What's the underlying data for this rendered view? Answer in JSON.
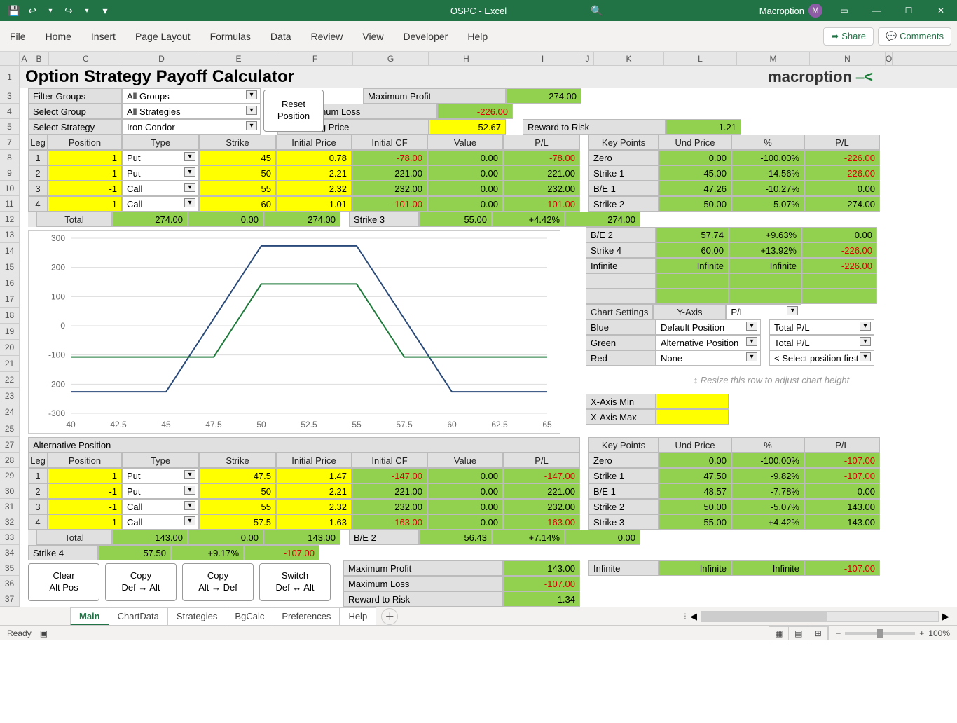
{
  "app": {
    "title": "OSPC  -  Excel",
    "account": "Macroption",
    "avatar_letter": "M"
  },
  "ribbon": {
    "tabs": [
      "File",
      "Home",
      "Insert",
      "Page Layout",
      "Formulas",
      "Data",
      "Review",
      "View",
      "Developer",
      "Help"
    ],
    "share": "Share",
    "comments": "Comments"
  },
  "col_headers": [
    "A",
    "B",
    "C",
    "D",
    "E",
    "F",
    "G",
    "H",
    "I",
    "J",
    "K",
    "L",
    "M",
    "N",
    "O"
  ],
  "row_numbers_top": [
    1,
    3,
    4,
    5,
    7,
    8,
    9,
    10,
    11,
    12,
    13,
    14,
    15,
    16,
    17,
    18,
    19,
    20,
    21,
    22,
    23,
    24,
    25,
    27,
    28,
    29,
    30,
    31,
    32,
    33,
    34,
    35,
    36,
    37
  ],
  "title": "Option Strategy Payoff Calculator",
  "brand": "macroption",
  "filters": {
    "filter_groups_label": "Filter Groups",
    "select_group_label": "Select Group",
    "select_strategy_label": "Select Strategy",
    "filter_groups_value": "All Groups",
    "select_group_value": "All Strategies",
    "select_strategy_value": "Iron Condor",
    "reset_btn_l1": "Reset",
    "reset_btn_l2": "Position",
    "underlying_label": "Underlying Price",
    "underlying_value": "52.67"
  },
  "summary_top": {
    "max_profit_label": "Maximum Profit",
    "max_profit": "274.00",
    "max_loss_label": "Maximum Loss",
    "max_loss": "-226.00",
    "reward_label": "Reward to Risk",
    "reward": "1.21"
  },
  "pos_headers": [
    "Leg",
    "Position",
    "Type",
    "Strike",
    "Initial Price",
    "Initial CF",
    "Value",
    "P/L"
  ],
  "legs_main": [
    {
      "leg": "1",
      "pos": "1",
      "type": "Put",
      "strike": "45",
      "iprice": "0.78",
      "icf": "-78.00",
      "value": "0.00",
      "pl": "-78.00",
      "icf_neg": true,
      "pl_neg": true
    },
    {
      "leg": "2",
      "pos": "-1",
      "type": "Put",
      "strike": "50",
      "iprice": "2.21",
      "icf": "221.00",
      "value": "0.00",
      "pl": "221.00",
      "icf_neg": false,
      "pl_neg": false
    },
    {
      "leg": "3",
      "pos": "-1",
      "type": "Call",
      "strike": "55",
      "iprice": "2.32",
      "icf": "232.00",
      "value": "0.00",
      "pl": "232.00",
      "icf_neg": false,
      "pl_neg": false
    },
    {
      "leg": "4",
      "pos": "1",
      "type": "Call",
      "strike": "60",
      "iprice": "1.01",
      "icf": "-101.00",
      "value": "0.00",
      "pl": "-101.00",
      "icf_neg": true,
      "pl_neg": true
    }
  ],
  "total_label": "Total",
  "totals_main": {
    "icf": "274.00",
    "value": "0.00",
    "pl": "274.00"
  },
  "keypoints_headers": [
    "Key Points",
    "Und Price",
    "%",
    "P/L"
  ],
  "keypoints_top": [
    {
      "name": "Zero",
      "price": "0.00",
      "pct": "-100.00%",
      "pl": "-226.00",
      "pl_neg": true
    },
    {
      "name": "Strike 1",
      "price": "45.00",
      "pct": "-14.56%",
      "pl": "-226.00",
      "pl_neg": true
    },
    {
      "name": "B/E 1",
      "price": "47.26",
      "pct": "-10.27%",
      "pl": "0.00",
      "pl_neg": false
    },
    {
      "name": "Strike 2",
      "price": "50.00",
      "pct": "-5.07%",
      "pl": "274.00",
      "pl_neg": false
    },
    {
      "name": "Strike 3",
      "price": "55.00",
      "pct": "+4.42%",
      "pl": "274.00",
      "pl_neg": false
    },
    {
      "name": "B/E 2",
      "price": "57.74",
      "pct": "+9.63%",
      "pl": "0.00",
      "pl_neg": false
    },
    {
      "name": "Strike 4",
      "price": "60.00",
      "pct": "+13.92%",
      "pl": "-226.00",
      "pl_neg": true
    },
    {
      "name": "Infinite",
      "price": "Infinite",
      "pct": "Infinite",
      "pl": "-226.00",
      "pl_neg": true
    }
  ],
  "chart_settings": {
    "header": "Chart Settings",
    "yaxis_label": "Y-Axis",
    "yaxis_value": "P/L",
    "rows": [
      {
        "color": "Blue",
        "pos": "Default Position",
        "metric": "Total P/L"
      },
      {
        "color": "Green",
        "pos": "Alternative Position",
        "metric": "Total P/L"
      },
      {
        "color": "Red",
        "pos": "None",
        "metric": "< Select position first"
      }
    ],
    "resize_hint": "↕ Resize this row to adjust chart height",
    "xmin_label": "X-Axis Min",
    "xmax_label": "X-Axis Max"
  },
  "chart_data": {
    "type": "line",
    "x": [
      40,
      42.5,
      45,
      47.5,
      50,
      52.5,
      55,
      57.5,
      60,
      62.5,
      65
    ],
    "series": [
      {
        "name": "Default Position",
        "color": "#2a4a7a",
        "values": [
          -226,
          -226,
          -226,
          24,
          274,
          274,
          274,
          24,
          -226,
          -226,
          -226
        ]
      },
      {
        "name": "Alternative Position",
        "color": "#1e7a3a",
        "values": [
          -107,
          -107,
          -107,
          -107,
          143,
          143,
          143,
          -107,
          -107,
          -107,
          -107
        ]
      }
    ],
    "xlabel": "",
    "ylabel": "",
    "ylim": [
      -300,
      300
    ],
    "yticks": [
      -300,
      -200,
      -100,
      0,
      100,
      200,
      300
    ],
    "xticks": [
      40,
      42.5,
      45,
      47.5,
      50,
      52.5,
      55,
      57.5,
      60,
      62.5,
      65
    ]
  },
  "alt_header": "Alternative Position",
  "legs_alt": [
    {
      "leg": "1",
      "pos": "1",
      "type": "Put",
      "strike": "47.5",
      "iprice": "1.47",
      "icf": "-147.00",
      "value": "0.00",
      "pl": "-147.00",
      "icf_neg": true,
      "pl_neg": true
    },
    {
      "leg": "2",
      "pos": "-1",
      "type": "Put",
      "strike": "50",
      "iprice": "2.21",
      "icf": "221.00",
      "value": "0.00",
      "pl": "221.00",
      "icf_neg": false,
      "pl_neg": false
    },
    {
      "leg": "3",
      "pos": "-1",
      "type": "Call",
      "strike": "55",
      "iprice": "2.32",
      "icf": "232.00",
      "value": "0.00",
      "pl": "232.00",
      "icf_neg": false,
      "pl_neg": false
    },
    {
      "leg": "4",
      "pos": "1",
      "type": "Call",
      "strike": "57.5",
      "iprice": "1.63",
      "icf": "-163.00",
      "value": "0.00",
      "pl": "-163.00",
      "icf_neg": true,
      "pl_neg": true
    }
  ],
  "totals_alt": {
    "icf": "143.00",
    "value": "0.00",
    "pl": "143.00"
  },
  "keypoints_bot": [
    {
      "name": "Zero",
      "price": "0.00",
      "pct": "-100.00%",
      "pl": "-107.00",
      "pl_neg": true
    },
    {
      "name": "Strike 1",
      "price": "47.50",
      "pct": "-9.82%",
      "pl": "-107.00",
      "pl_neg": true
    },
    {
      "name": "B/E 1",
      "price": "48.57",
      "pct": "-7.78%",
      "pl": "0.00",
      "pl_neg": false
    },
    {
      "name": "Strike 2",
      "price": "50.00",
      "pct": "-5.07%",
      "pl": "143.00",
      "pl_neg": false
    },
    {
      "name": "Strike 3",
      "price": "55.00",
      "pct": "+4.42%",
      "pl": "143.00",
      "pl_neg": false
    },
    {
      "name": "B/E 2",
      "price": "56.43",
      "pct": "+7.14%",
      "pl": "0.00",
      "pl_neg": false
    },
    {
      "name": "Strike 4",
      "price": "57.50",
      "pct": "+9.17%",
      "pl": "-107.00",
      "pl_neg": true
    },
    {
      "name": "Infinite",
      "price": "Infinite",
      "pct": "Infinite",
      "pl": "-107.00",
      "pl_neg": true
    }
  ],
  "action_buttons": [
    {
      "l1": "Clear",
      "l2": "Alt Pos"
    },
    {
      "l1": "Copy",
      "l2": "Def → Alt"
    },
    {
      "l1": "Copy",
      "l2": "Alt → Def"
    },
    {
      "l1": "Switch",
      "l2": "Def ↔ Alt"
    }
  ],
  "summary_bot": {
    "max_profit_label": "Maximum Profit",
    "max_profit": "143.00",
    "max_loss_label": "Maximum Loss",
    "max_loss": "-107.00",
    "reward_label": "Reward to Risk",
    "reward": "1.34"
  },
  "sheet_tabs": [
    "Main",
    "ChartData",
    "Strategies",
    "BgCalc",
    "Preferences",
    "Help"
  ],
  "active_tab": 0,
  "status": {
    "ready": "Ready",
    "zoom": "100%"
  }
}
